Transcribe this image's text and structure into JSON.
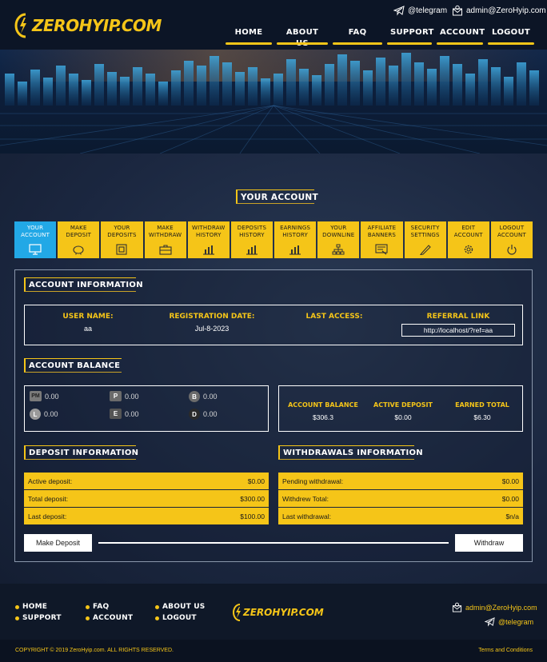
{
  "header": {
    "logo_text": "ZEROHYIP.COM",
    "telegram": "@telegram",
    "email": "admin@ZeroHyip.com",
    "nav": [
      {
        "label": "HOME"
      },
      {
        "label": "ABOUT US"
      },
      {
        "label": "FAQ"
      },
      {
        "label": "SUPPORT"
      },
      {
        "label": "ACCOUNT"
      },
      {
        "label": "LOGOUT"
      }
    ]
  },
  "page": {
    "title": "YOUR ACCOUNT"
  },
  "tabs": [
    {
      "line1": "YOUR",
      "line2": "ACCOUNT",
      "icon": "monitor-icon",
      "active": true
    },
    {
      "line1": "MAKE",
      "line2": "DEPOSIT",
      "icon": "piggy-bank-icon"
    },
    {
      "line1": "YOUR",
      "line2": "DEPOSITS",
      "icon": "safe-icon"
    },
    {
      "line1": "MAKE",
      "line2": "WITHDRAW",
      "icon": "briefcase-icon"
    },
    {
      "line1": "WITHDRAW",
      "line2": "HISTORY",
      "icon": "chart-icon"
    },
    {
      "line1": "DEPOSITS",
      "line2": "HISTORY",
      "icon": "chart-icon"
    },
    {
      "line1": "EARNINGS",
      "line2": "HISTORY",
      "icon": "chart-icon"
    },
    {
      "line1": "YOUR",
      "line2": "DOWNLINE",
      "icon": "network-icon"
    },
    {
      "line1": "AFFILIATE",
      "line2": "BANNERS",
      "icon": "banner-icon"
    },
    {
      "line1": "SECURITY",
      "line2": "SETTINGS",
      "icon": "pencil-icon"
    },
    {
      "line1": "EDIT",
      "line2": "ACCOUNT",
      "icon": "gear-icon"
    },
    {
      "line1": "LOGOUT",
      "line2": "ACCOUNT",
      "icon": "power-icon"
    }
  ],
  "account_info": {
    "title": "ACCOUNT INFORMATION",
    "username_label": "USER NAME:",
    "username": "aa",
    "reg_label": "REGISTRATION DATE:",
    "reg_date": "Jul-8-2023",
    "last_access_label": "LAST ACCESS:",
    "last_access": "",
    "referral_label": "REFERRAL LINK",
    "referral_link": "http://localhost/?ref=aa"
  },
  "balance": {
    "title": "ACCOUNT BALANCE",
    "coins": [
      {
        "icon": "PM",
        "value": "0.00"
      },
      {
        "icon": "P",
        "value": "0.00"
      },
      {
        "icon": "B",
        "value": "0.00"
      },
      {
        "icon": "L",
        "value": "0.00"
      },
      {
        "icon": "E",
        "value": "0.00"
      },
      {
        "icon": "D",
        "value": "0.00"
      }
    ],
    "summary": [
      {
        "label": "ACCOUNT BALANCE",
        "value": "$306.3"
      },
      {
        "label": "ACTIVE DEPOSIT",
        "value": "$0.00"
      },
      {
        "label": "EARNED TOTAL",
        "value": "$6.30"
      }
    ]
  },
  "deposit_info": {
    "title": "DEPOSIT INFORMATION",
    "rows": [
      {
        "label": "Active deposit:",
        "value": "$0.00"
      },
      {
        "label": "Total deposit:",
        "value": "$300.00"
      },
      {
        "label": "Last deposit:",
        "value": "$100.00"
      }
    ],
    "button": "Make Deposit"
  },
  "withdraw_info": {
    "title": "WITHDRAWALS INFORMATION",
    "rows": [
      {
        "label": "Pending withdrawal:",
        "value": "$0.00"
      },
      {
        "label": "Withdrew Total:",
        "value": "$0.00"
      },
      {
        "label": "Last withdrawal:",
        "value": "$n/a"
      }
    ],
    "button": "Withdraw"
  },
  "footer": {
    "links_col1": [
      "HOME",
      "SUPPORT"
    ],
    "links_col2": [
      "FAQ",
      "ACCOUNT"
    ],
    "links_col3": [
      "ABOUT US",
      "LOGOUT"
    ],
    "logo_text": "ZEROHYIP.COM",
    "email": "admin@ZeroHyip.com",
    "telegram": "@telegram",
    "copyright": "COPYRIGHT © 2019 ZeroHyip.com. ALL RIGHTS RESERVED.",
    "terms": "Terms and Conditions"
  },
  "colors": {
    "accent": "#f5c518",
    "active_tab": "#22a8e6",
    "background": "#1a2436"
  }
}
